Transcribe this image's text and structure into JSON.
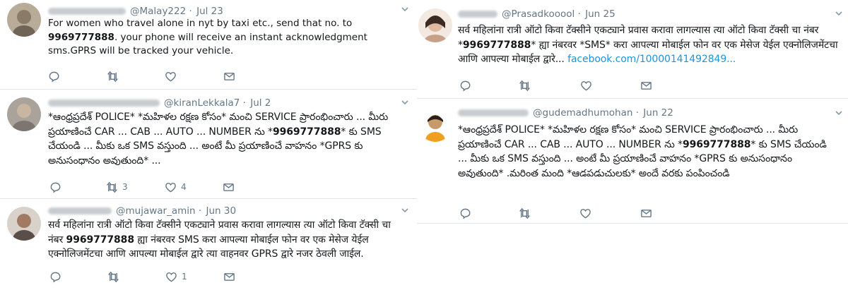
{
  "tweets": [
    {
      "handle": "@Malay222",
      "dot": "·",
      "date": "Jul 23",
      "text": "For women who travel alone in nyt by taxi etc., send that no. to ",
      "number": "9969777888",
      "text_after": ". your phone will receive an instant acknowledgment sms.GPRS will be tracked your vehicle.",
      "reply_count": "",
      "retweet_count": "",
      "like_count": ""
    },
    {
      "handle": "@kiranLekkala7",
      "dot": "·",
      "date": "Jul 2",
      "text": "*ఆంధ్రప్రదేశ్ POLICE* *మహిళల రక్షణ కోసం* మంచి SERVICE ప్రారంభించారు ... మీరు ప్రయాణించే CAR ... CAB ... AUTO ... NUMBER ను *",
      "number": "9969777888",
      "text_after": "* కు SMS చేయండి ... మీకు ఒక SMS వస్తుంది ... అంటే మీ ప్రయాణించే వాహనం *GPRS కు అనుసంధానం అవుతుంది* ...",
      "reply_count": "",
      "retweet_count": "3",
      "like_count": "4"
    },
    {
      "handle": "@mujawar_amin",
      "dot": "·",
      "date": "Jun 30",
      "text": "सर्व महिलांना रात्री ऑटो किवा टॅक्सीने एकट्याने प्रवास करावा लागल्यास त्या ऑटो किवा टॅक्सी चा नंबर ",
      "number": "9969777888",
      "text_after": " ह्या नंबरवर SMS करा आपल्या मोबाईल फोन वर एक मेसेज येईल एक्नोलिजमेंटचा आणि आपल्या मोबाईल द्वारे त्या वाहनवर GPRS द्वारे नजर ठेवली जाईल.",
      "reply_count": "",
      "retweet_count": "",
      "like_count": "1"
    },
    {
      "handle": "@Prasadkooool",
      "dot": "·",
      "date": "Jun 25",
      "text": "सर्व महिलांना रात्री ऑटो किवा टॅक्सीने एकट्याने प्रवास करावा लागल्यास त्या ऑटो किवा टॅक्सी चा नंबर *",
      "number": "9969777888",
      "text_after": "* ह्या नंबरवर *SMS* करा आपल्या मोबाईल फोन वर एक मेसेज येईल एक्नोलिजमेंटचा आणि आपल्या मोबाईल द्वारे... ",
      "link": "facebook.com/10000141492849...",
      "reply_count": "",
      "retweet_count": "",
      "like_count": ""
    },
    {
      "handle": "@gudemadhumohan",
      "dot": "·",
      "date": "Jun 22",
      "text": "*ఆంధ్రప్రదేశ్ POLICE* *మహిళల రక్షణ కోసం* మంచి SERVICE ప్రారంభించారు ... మీరు ప్రయాణించే CAR ... CAB ... AUTO ... NUMBER ను *",
      "number": "9969777888",
      "text_after": "* కు SMS చేయండి ... మీకు ఒక SMS వస్తుంది ... అంటే మీ ప్రయాణించే వాహనం *GPRS కు అనుసంధానం అవుతుంది* .మరింత మంది *ఆడపడుచులకు* అందే వరకు పంపించండి",
      "reply_count": "",
      "retweet_count": "",
      "like_count": ""
    }
  ],
  "icons": {
    "reply": "reply-icon",
    "retweet": "retweet-icon",
    "like": "heart-icon",
    "dm": "envelope-icon",
    "caret": "chevron-down-icon"
  },
  "colors": {
    "text": "#14171a",
    "secondary": "#657786",
    "link": "#1b95e0",
    "border": "#e1e8ed",
    "background": "#e6ecf0"
  }
}
